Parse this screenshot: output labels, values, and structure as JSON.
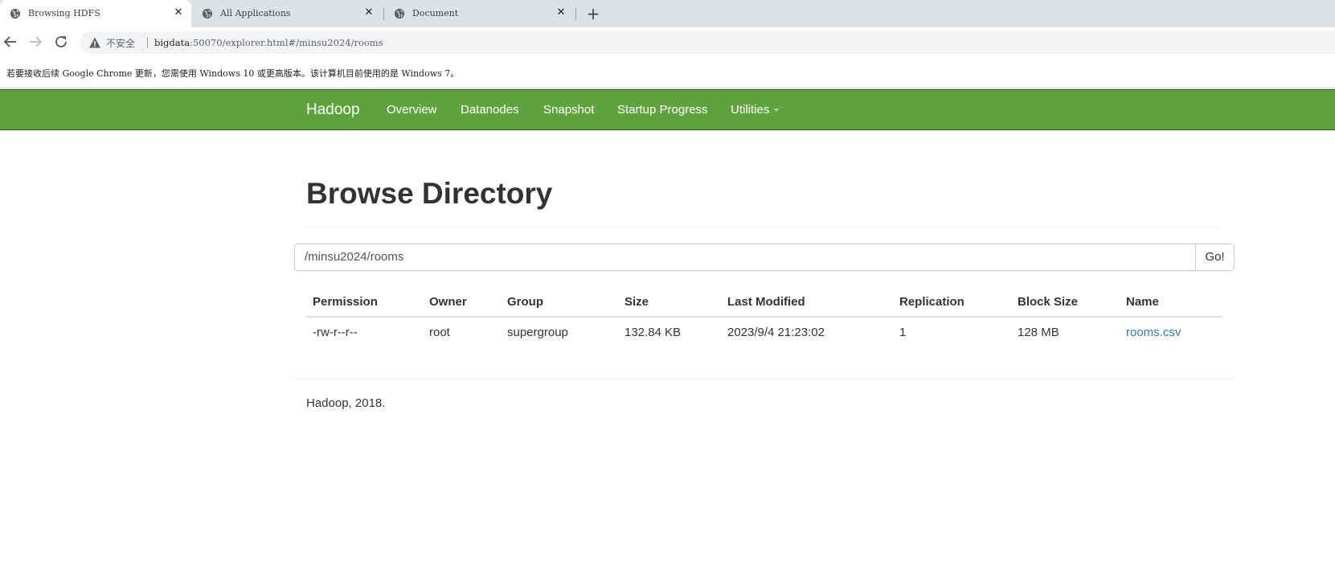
{
  "browser": {
    "tabs": [
      {
        "title": "Browsing HDFS",
        "active": true
      },
      {
        "title": "All Applications",
        "active": false
      },
      {
        "title": "Document",
        "active": false
      }
    ],
    "new_tab_label": "+",
    "close_label": "✕",
    "address": {
      "security_label": "不安全",
      "host": "bigdata",
      "rest": ":50070/explorer.html#/minsu2024/rooms"
    },
    "infobar_text": "若要接收后续 Google Chrome 更新，您需使用 Windows 10 或更高版本。该计算机目前使用的是 Windows 7。"
  },
  "navbar": {
    "brand": "Hadoop",
    "items": [
      "Overview",
      "Datanodes",
      "Snapshot",
      "Startup Progress",
      "Utilities"
    ],
    "bg_color": "#5fa33e"
  },
  "page": {
    "title": "Browse Directory",
    "path_value": "/minsu2024/rooms",
    "go_label": "Go!",
    "columns": [
      "Permission",
      "Owner",
      "Group",
      "Size",
      "Last Modified",
      "Replication",
      "Block Size",
      "Name"
    ],
    "rows": [
      {
        "permission": "-rw-r--r--",
        "owner": "root",
        "group": "supergroup",
        "size": "132.84 KB",
        "last_modified": "2023/9/4 21:23:02",
        "replication": "1",
        "block_size": "128 MB",
        "name": "rooms.csv"
      }
    ],
    "footer": "Hadoop, 2018."
  }
}
